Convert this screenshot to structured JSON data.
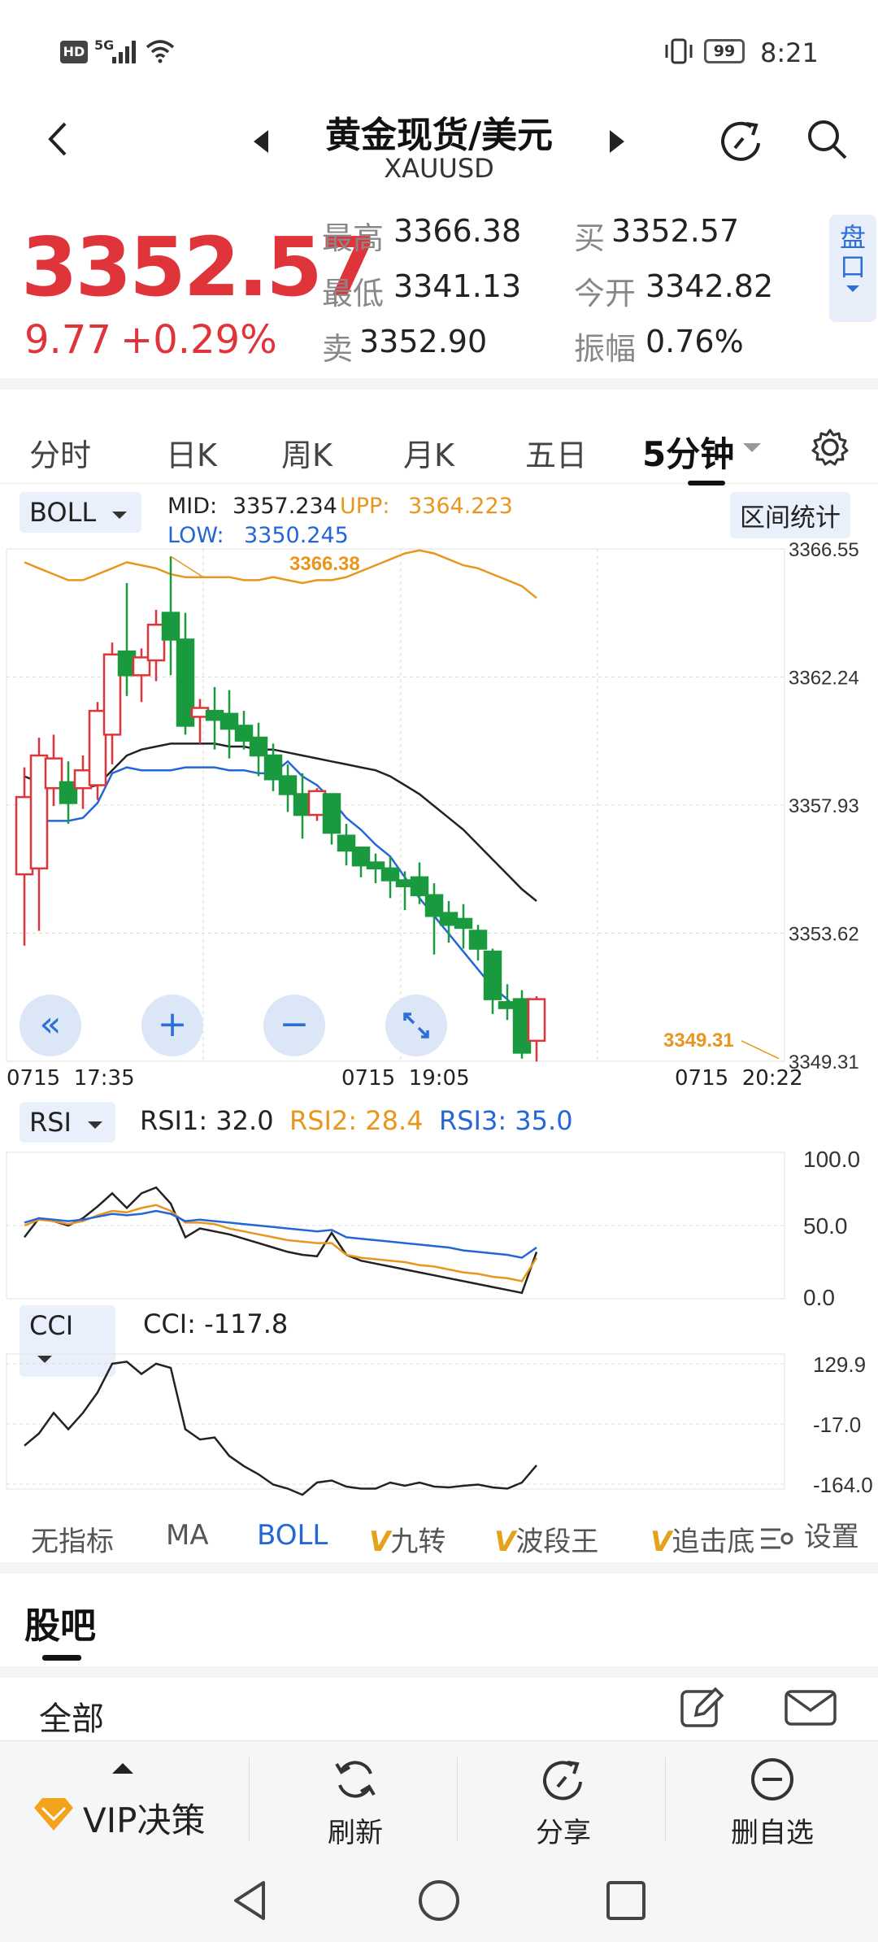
{
  "status": {
    "left_icons": "HD 5G signal wifi",
    "network": "5G",
    "battery": "99",
    "time": "8:21"
  },
  "header": {
    "title": "黄金现货/美元",
    "symbol": "XAUUSD"
  },
  "quote": {
    "price": "3352.57",
    "change": "9.77",
    "change_pct": "+0.29%",
    "high_label": "最高",
    "high": "3366.38",
    "low_label": "最低",
    "low": "3341.13",
    "sell_label": "卖",
    "sell": "3352.90",
    "buy_label": "买",
    "buy": "3352.57",
    "open_label": "今开",
    "open": "3342.82",
    "amp_label": "振幅",
    "amp": "0.76%",
    "panel_label": "盘口"
  },
  "tabs": [
    "分时",
    "日K",
    "周K",
    "月K",
    "五日",
    "5分钟"
  ],
  "boll": {
    "selector": "BOLL",
    "mid_label": "MID:",
    "mid": "3357.234",
    "upp_label": "UPP:",
    "upp": "3364.223",
    "low_label": "LOW:",
    "low": "3350.245",
    "range_stats": "区间统计",
    "y_ticks": [
      "3366.55",
      "3362.24",
      "3357.93",
      "3353.62",
      "3349.31"
    ],
    "max_annot": "3366.38",
    "min_annot": "3349.31",
    "time_labels": [
      "0715  17:35",
      "0715  19:05",
      "0715  20:22"
    ]
  },
  "rsi": {
    "selector": "RSI",
    "rsi1": "RSI1: 32.0",
    "rsi2": "RSI2: 28.4",
    "rsi3": "RSI3: 35.0",
    "y_ticks": [
      "100.0",
      "50.0",
      "0.0"
    ]
  },
  "cci": {
    "selector": "CCI",
    "value": "CCI: -117.8",
    "y_ticks": [
      "129.9",
      "-17.0",
      "-164.0"
    ]
  },
  "indicators": {
    "none": "无指标",
    "ma": "MA",
    "boll": "BOLL",
    "jiuzhuan": "九转",
    "boduan": "波段王",
    "zhuiji": "追击底",
    "settings": "设置"
  },
  "guba": {
    "title": "股吧",
    "all": "全部"
  },
  "bottom_nav": {
    "vip": "VIP决策",
    "refresh": "刷新",
    "share": "分享",
    "remove": "删自选"
  },
  "colors": {
    "red": "#e0343b",
    "green": "#1a9a3f",
    "orange": "#e8961e",
    "blue": "#2466d6",
    "black": "#222222"
  },
  "chart_data": [
    {
      "type": "candlestick",
      "title": "BOLL 5分钟",
      "ylim": [
        3349.31,
        3366.55
      ],
      "candles": [
        {
          "o": 3355.6,
          "c": 3358.2,
          "h": 3359.2,
          "l": 3353.2
        },
        {
          "o": 3355.8,
          "c": 3359.6,
          "h": 3360.2,
          "l": 3353.7
        },
        {
          "o": 3358.5,
          "c": 3359.5,
          "h": 3360.3,
          "l": 3357.9
        },
        {
          "o": 3358.7,
          "c": 3358.0,
          "h": 3359.4,
          "l": 3357.3
        },
        {
          "o": 3358.5,
          "c": 3359.1,
          "h": 3359.6,
          "l": 3357.8
        },
        {
          "o": 3358.6,
          "c": 3361.1,
          "h": 3361.4,
          "l": 3358.1
        },
        {
          "o": 3360.3,
          "c": 3363.0,
          "h": 3363.4,
          "l": 3359.3
        },
        {
          "o": 3363.1,
          "c": 3362.3,
          "h": 3365.4,
          "l": 3361.6
        },
        {
          "o": 3362.3,
          "c": 3362.9,
          "h": 3363.2,
          "l": 3361.4
        },
        {
          "o": 3362.8,
          "c": 3364.0,
          "h": 3364.5,
          "l": 3362.1
        },
        {
          "o": 3364.4,
          "c": 3363.5,
          "h": 3366.3,
          "l": 3362.3
        },
        {
          "o": 3363.5,
          "c": 3360.6,
          "h": 3364.4,
          "l": 3360.3
        },
        {
          "o": 3360.9,
          "c": 3361.2,
          "h": 3361.5,
          "l": 3360.0
        },
        {
          "o": 3361.1,
          "c": 3360.8,
          "h": 3361.9,
          "l": 3359.8
        },
        {
          "o": 3361.0,
          "c": 3360.5,
          "h": 3361.8,
          "l": 3359.5
        },
        {
          "o": 3360.6,
          "c": 3360.1,
          "h": 3361.1,
          "l": 3359.8
        },
        {
          "o": 3360.2,
          "c": 3359.6,
          "h": 3360.7,
          "l": 3358.9
        },
        {
          "o": 3359.6,
          "c": 3358.8,
          "h": 3360.0,
          "l": 3358.4
        },
        {
          "o": 3358.9,
          "c": 3358.3,
          "h": 3359.3,
          "l": 3357.7
        },
        {
          "o": 3358.3,
          "c": 3357.6,
          "h": 3359.0,
          "l": 3356.8
        },
        {
          "o": 3357.6,
          "c": 3358.4,
          "h": 3358.5,
          "l": 3357.4
        },
        {
          "o": 3358.3,
          "c": 3357.0,
          "h": 3358.3,
          "l": 3356.6
        },
        {
          "o": 3356.9,
          "c": 3356.4,
          "h": 3357.3,
          "l": 3355.9
        },
        {
          "o": 3356.5,
          "c": 3355.9,
          "h": 3356.5,
          "l": 3355.5
        },
        {
          "o": 3356.0,
          "c": 3355.8,
          "h": 3356.3,
          "l": 3355.3
        },
        {
          "o": 3355.8,
          "c": 3355.4,
          "h": 3356.2,
          "l": 3354.8
        },
        {
          "o": 3355.4,
          "c": 3355.2,
          "h": 3355.7,
          "l": 3354.4
        },
        {
          "o": 3355.5,
          "c": 3354.9,
          "h": 3356.0,
          "l": 3354.6
        },
        {
          "o": 3354.9,
          "c": 3354.2,
          "h": 3355.3,
          "l": 3352.9
        },
        {
          "o": 3354.3,
          "c": 3353.9,
          "h": 3354.7,
          "l": 3353.3
        },
        {
          "o": 3354.1,
          "c": 3353.8,
          "h": 3354.6,
          "l": 3353.1
        },
        {
          "o": 3353.7,
          "c": 3353.1,
          "h": 3353.9,
          "l": 3352.7
        },
        {
          "o": 3353.0,
          "c": 3351.4,
          "h": 3353.1,
          "l": 3350.9
        },
        {
          "o": 3351.3,
          "c": 3351.1,
          "h": 3351.9,
          "l": 3350.7
        },
        {
          "o": 3351.4,
          "c": 3349.6,
          "h": 3351.7,
          "l": 3349.4
        },
        {
          "o": 3350.0,
          "c": 3351.4,
          "h": 3351.5,
          "l": 3349.3
        }
      ],
      "upp": [
        3366.1,
        3365.9,
        3365.7,
        3365.5,
        3365.5,
        3365.7,
        3365.9,
        3366.1,
        3366.0,
        3365.9,
        3365.7,
        3365.6,
        3365.6,
        3365.6,
        3365.6,
        3365.5,
        3365.5,
        3365.6,
        3365.5,
        3365.4,
        3365.5,
        3365.5,
        3365.6,
        3365.8,
        3366.0,
        3366.2,
        3366.4,
        3366.5,
        3366.4,
        3366.2,
        3366.0,
        3365.9,
        3365.7,
        3365.5,
        3365.3,
        3364.9
      ],
      "mid": [
        3358.9,
        3358.7,
        3358.7,
        3358.6,
        3358.5,
        3358.6,
        3359.1,
        3359.6,
        3359.8,
        3359.9,
        3360.0,
        3360.0,
        3360.0,
        3360.0,
        3359.9,
        3359.9,
        3359.8,
        3359.8,
        3359.7,
        3359.6,
        3359.5,
        3359.4,
        3359.3,
        3359.2,
        3359.1,
        3358.9,
        3358.6,
        3358.3,
        3357.9,
        3357.5,
        3357.1,
        3356.6,
        3356.1,
        3355.6,
        3355.1,
        3354.7
      ],
      "low": [
        3357.4,
        3357.4,
        3357.4,
        3357.4,
        3357.5,
        3358.0,
        3359.0,
        3359.2,
        3359.1,
        3359.1,
        3359.1,
        3359.2,
        3359.2,
        3359.2,
        3359.1,
        3359.1,
        3359.0,
        3359.0,
        3359.4,
        3358.9,
        3358.6,
        3358.1,
        3357.5,
        3357.1,
        3356.6,
        3356.2,
        3355.5,
        3354.8,
        3354.2,
        3353.6,
        3353.0,
        3352.4,
        3351.8,
        3351.4,
        3350.8,
        3350.2
      ]
    },
    {
      "type": "line",
      "title": "RSI",
      "ylim": [
        0,
        100
      ],
      "series": [
        {
          "name": "RSI1",
          "values": [
            42,
            55,
            53,
            50,
            55,
            63,
            72,
            62,
            72,
            76,
            65,
            42,
            48,
            46,
            44,
            41,
            38,
            35,
            32,
            30,
            29,
            45,
            30,
            26,
            24,
            22,
            20,
            18,
            16,
            14,
            12,
            10,
            8,
            6,
            4,
            32
          ]
        },
        {
          "name": "RSI2",
          "values": [
            50,
            54,
            53,
            51,
            53,
            57,
            60,
            59,
            62,
            64,
            60,
            52,
            52,
            51,
            48,
            46,
            44,
            42,
            40,
            39,
            38,
            38,
            30,
            28,
            27,
            26,
            25,
            23,
            22,
            20,
            18,
            17,
            15,
            14,
            12,
            28
          ]
        },
        {
          "name": "RSI3",
          "values": [
            52,
            55,
            54,
            53,
            54,
            56,
            58,
            57,
            58,
            60,
            58,
            53,
            54,
            53,
            52,
            51,
            50,
            49,
            48,
            47,
            46,
            47,
            42,
            41,
            40,
            39,
            38,
            37,
            36,
            35,
            33,
            32,
            31,
            30,
            28,
            35
          ]
        }
      ]
    },
    {
      "type": "line",
      "title": "CCI",
      "ylim": [
        -164,
        129.9
      ],
      "series": [
        {
          "name": "CCI",
          "values": [
            -70,
            -40,
            10,
            -30,
            10,
            60,
            130,
            135,
            105,
            130,
            120,
            -30,
            -55,
            -50,
            -95,
            -120,
            -140,
            -165,
            -175,
            -190,
            -160,
            -155,
            -170,
            -175,
            -175,
            -160,
            -168,
            -160,
            -170,
            -172,
            -168,
            -165,
            -172,
            -175,
            -160,
            -118
          ]
        }
      ]
    }
  ]
}
